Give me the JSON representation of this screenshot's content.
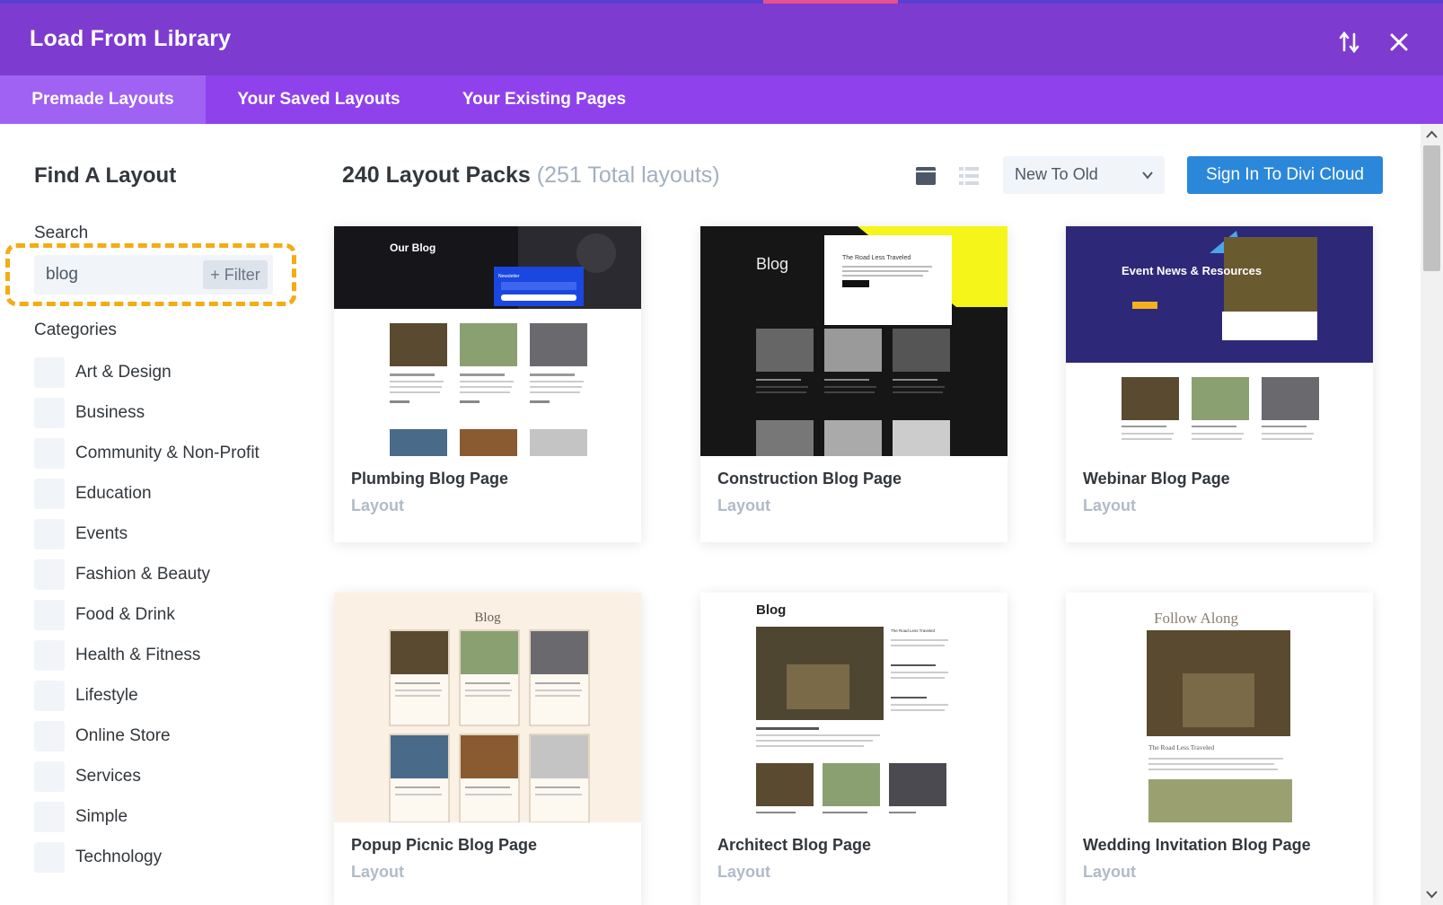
{
  "header": {
    "title": "Load From Library",
    "sort_icon": "sort-arrows-icon",
    "close_icon": "close-icon"
  },
  "tabs": [
    {
      "label": "Premade Layouts",
      "active": true
    },
    {
      "label": "Your Saved Layouts",
      "active": false
    },
    {
      "label": "Your Existing Pages",
      "active": false
    }
  ],
  "sidebar": {
    "title": "Find A Layout",
    "search_label": "Search",
    "search_value": "blog",
    "filter_label": "+ Filter",
    "categories_label": "Categories",
    "categories": [
      "Art & Design",
      "Business",
      "Community & Non-Profit",
      "Education",
      "Events",
      "Fashion & Beauty",
      "Food & Drink",
      "Health & Fitness",
      "Lifestyle",
      "Online Store",
      "Services",
      "Simple",
      "Technology"
    ]
  },
  "main": {
    "count_title": "240 Layout Packs",
    "count_sub": "(251 Total layouts)",
    "sort_value": "New To Old",
    "cloud_button": "Sign In To Divi Cloud"
  },
  "cards": [
    {
      "name": "Plumbing Blog Page",
      "type": "Layout",
      "thumb_text": "Our Blog",
      "thumb_sub": "Newsletter"
    },
    {
      "name": "Construction Blog Page",
      "type": "Layout",
      "thumb_text": "Blog",
      "thumb_sub": "The Road Less Traveled"
    },
    {
      "name": "Webinar Blog Page",
      "type": "Layout",
      "thumb_text": "Event News & Resources",
      "thumb_sub": ""
    },
    {
      "name": "Popup Picnic Blog Page",
      "type": "Layout",
      "thumb_text": "Blog",
      "thumb_sub": ""
    },
    {
      "name": "Architect Blog Page",
      "type": "Layout",
      "thumb_text": "Blog",
      "thumb_sub": "The Road Less Traveled"
    },
    {
      "name": "Wedding Invitation Blog Page",
      "type": "Layout",
      "thumb_text": "Follow Along",
      "thumb_sub": "The Road Less Traveled"
    }
  ],
  "colors": {
    "header_bg": "#7e3bd0",
    "tabs_bg": "#8f42ec",
    "active_tab_bg": "#a062f2",
    "cloud_button": "#2b87da",
    "highlight": "#f3ac14"
  }
}
